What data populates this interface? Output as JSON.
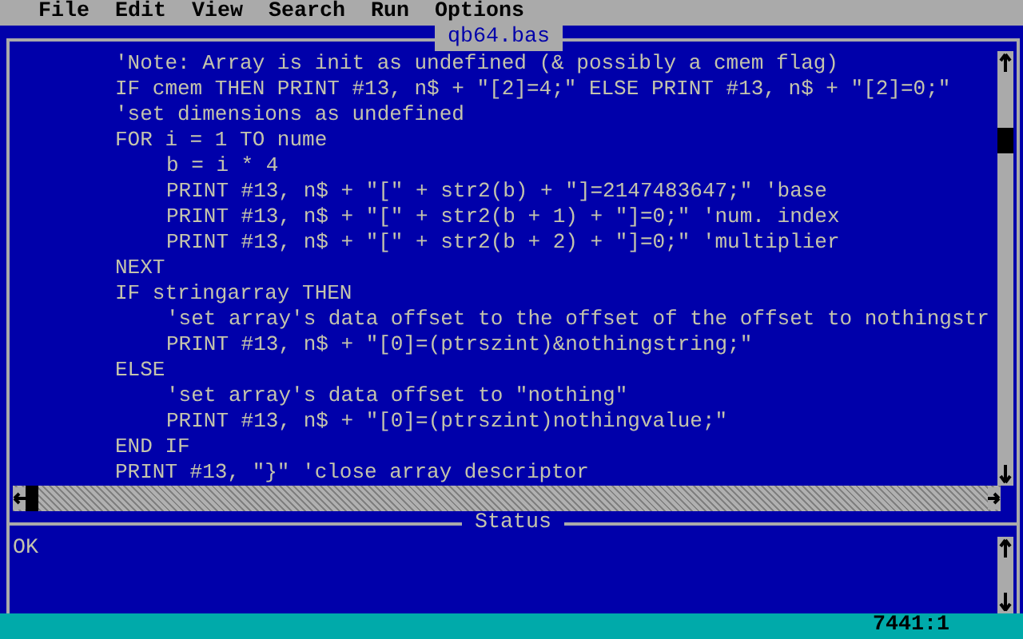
{
  "menu": [
    "File",
    "Edit",
    "View",
    "Search",
    "Run",
    "Options"
  ],
  "editor": {
    "title": "qb64.bas",
    "lines": [
      {
        "text": "'Note: Array is init as undefined (& possibly a cmem flag)"
      },
      {
        "text": "IF cmem THEN PRINT #13, n$ + \"[2]=4;\" ELSE PRINT #13, n$ + \"[2]=0;\""
      },
      {
        "text": "'set dimensions as undefined"
      },
      {
        "text": "FOR i = 1 TO nume",
        "children": [
          {
            "text": "b = i * 4"
          },
          {
            "text": "PRINT #13, n$ + \"[\" + str2(b) + \"]=2147483647;\" 'base"
          },
          {
            "text": "PRINT #13, n$ + \"[\" + str2(b + 1) + \"]=0;\" 'num. index"
          },
          {
            "text": "PRINT #13, n$ + \"[\" + str2(b + 2) + \"]=0;\" 'multiplier"
          }
        ]
      },
      {
        "text": "NEXT"
      },
      {
        "text": "IF stringarray THEN",
        "children": [
          {
            "text": "'set array's data offset to the offset of the offset to nothingstr"
          },
          {
            "text": "PRINT #13, n$ + \"[0]=(ptrszint)&nothingstring;\""
          }
        ]
      },
      {
        "text": "ELSE",
        "children": [
          {
            "text": "'set array's data offset to \"nothing\""
          },
          {
            "text": "PRINT #13, n$ + \"[0]=(ptrszint)nothingvalue;\""
          }
        ]
      },
      {
        "text": "END IF"
      },
      {
        "text": "PRINT #13, \"}\" 'close array descriptor"
      }
    ]
  },
  "status_pane": {
    "title": "Status",
    "messages": [
      "OK"
    ]
  },
  "status_bar": {
    "position": "7441:1"
  }
}
